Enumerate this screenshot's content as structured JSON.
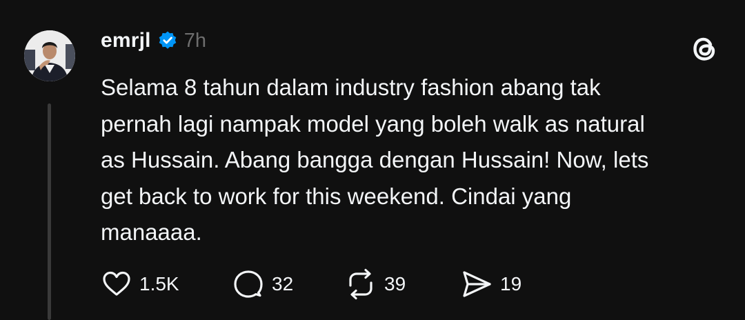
{
  "post": {
    "username": "emrjl",
    "verified": true,
    "timestamp": "7h",
    "text": "Selama 8 tahun dalam industry fashion abang tak\npernah lagi nampak model yang boleh walk as natural\nas Hussain. Abang bangga dengan Hussain! Now, lets\nget back to work for this weekend. Cindai yang\nmanaaaa.",
    "actions": {
      "like": {
        "icon": "heart-icon",
        "count": "1.5K"
      },
      "reply": {
        "icon": "comment-icon",
        "count": "32"
      },
      "repost": {
        "icon": "repost-icon",
        "count": "39"
      },
      "share": {
        "icon": "send-icon",
        "count": "19"
      }
    }
  },
  "colors": {
    "background": "#101010",
    "text": "#f3f5f7",
    "secondary": "#6e6e6e",
    "verified_badge": "#0095f6",
    "thread_line": "#3a3a3a"
  },
  "app": {
    "logo": "threads-logo-icon"
  }
}
